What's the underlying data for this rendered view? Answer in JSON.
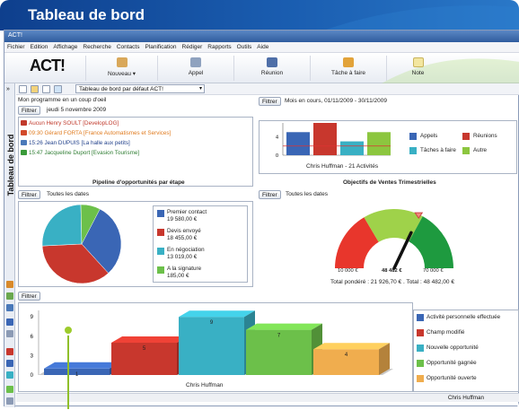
{
  "banner": {
    "title": "Tableau de bord"
  },
  "window": {
    "title": "ACT!"
  },
  "menu": [
    "Fichier",
    "Edition",
    "Affichage",
    "Recherche",
    "Contacts",
    "Planification",
    "Rédiger",
    "Rapports",
    "Outils",
    "Aide"
  ],
  "toolbar": {
    "logo": "ACT!",
    "buttons": [
      "Nouveau",
      "Appel",
      "Réunion",
      "Tâche à faire",
      "Note"
    ]
  },
  "sidebar": {
    "label": "Tableau de bord"
  },
  "subbar": {
    "layout": "Tableau de bord par défaut ACT!"
  },
  "common": {
    "filter": "Filtrer"
  },
  "programme": {
    "title": "Mon programme en un coup d'oeil",
    "date": "jeudi 5 novembre 2009",
    "items": [
      {
        "text": "Aucun Henry SOULT [DevelopLOG]",
        "color": "#c0392b",
        "icon": "#c0392b"
      },
      {
        "text": "09:30 Gérard FORTA [France Automatismes et Services]",
        "color": "#e07b1f",
        "icon": "#d24a2a"
      },
      {
        "text": "15:26 Jean DUPUIS [La halle aux petits]",
        "color": "#1f3f8a",
        "icon": "#4a79b9"
      },
      {
        "text": "15:47 Jacqueline Duport [Evasion Tourisme]",
        "color": "#2e7d32",
        "icon": "#3a9a3a"
      }
    ]
  },
  "activities": {
    "period": "Mois en cours, 01/11/2009 - 30/11/2009",
    "caption": "Chris Huffman - 21 Activités",
    "legend": [
      {
        "name": "Appels",
        "color": "#3a66b5"
      },
      {
        "name": "Réunions",
        "color": "#c8372d"
      },
      {
        "name": "Tâches à faire",
        "color": "#39b0c4"
      },
      {
        "name": "Autre",
        "color": "#8cc63f"
      }
    ]
  },
  "pipeline": {
    "title": "Pipeline d'opportunités par étape",
    "dates": "Toutes les dates",
    "legend": [
      {
        "name": "Premier contact",
        "value": "19 580,00 €",
        "color": "#3a66b5"
      },
      {
        "name": "Devis envoyé",
        "value": "18 455,00 €",
        "color": "#c8372d"
      },
      {
        "name": "En négociation",
        "value": "13 019,00 €",
        "color": "#39b0c4"
      },
      {
        "name": "A la signature",
        "value": "185,00 €",
        "color": "#6cc04a"
      }
    ]
  },
  "objectifs": {
    "title": "Objectifs de Ventes Trimestrielles",
    "dates": "Toutes les dates",
    "min": "10 000 €",
    "value": "48 482 €",
    "max": "70 000 €",
    "total": "Total pondéré : 21 926,70 € . Total : 48 482,00 €"
  },
  "history": {
    "caption": "Chris Huffman",
    "legend": [
      {
        "name": "Activité personnelle effectuée",
        "color": "#3a66b5"
      },
      {
        "name": "Champ modifié",
        "color": "#c8372d"
      },
      {
        "name": "Nouvelle opportunité",
        "color": "#39b0c4"
      },
      {
        "name": "Opportunité gagnée",
        "color": "#6cc04a"
      },
      {
        "name": "Opportunité ouverte",
        "color": "#f0ad4e"
      }
    ]
  },
  "status": {
    "user": "Chris Huffman"
  },
  "chart_data": [
    {
      "type": "bar",
      "title": "",
      "caption": "Chris Huffman - 21 Activités",
      "categories": [
        "Appels",
        "Réunions",
        "Tâches à faire",
        "Autre"
      ],
      "values": [
        5,
        7,
        3,
        5
      ],
      "ylim": [
        0,
        7
      ],
      "yticks": [
        0,
        4
      ],
      "reference_line": 2
    },
    {
      "type": "pie",
      "title": "Pipeline d'opportunités par étape",
      "labels": [
        "Premier contact",
        "Devis envoyé",
        "En négociation",
        "A la signature"
      ],
      "values": [
        19580,
        18455,
        13019,
        185
      ],
      "colors": [
        "#3a66b5",
        "#c8372d",
        "#39b0c4",
        "#6cc04a"
      ]
    },
    {
      "type": "gauge",
      "title": "Objectifs de Ventes Trimestrielles",
      "min": 10000,
      "max": 70000,
      "value": 48482
    },
    {
      "type": "bar",
      "title": "",
      "caption": "Chris Huffman",
      "categories": [
        "Activité personnelle effectuée",
        "Champ modifié",
        "Nouvelle opportunité",
        "Opportunité gagnée",
        "Opportunité ouverte"
      ],
      "values": [
        1,
        5,
        9,
        7,
        4
      ],
      "ylim": [
        0,
        10
      ],
      "yticks": [
        0,
        3,
        6,
        9
      ]
    }
  ]
}
